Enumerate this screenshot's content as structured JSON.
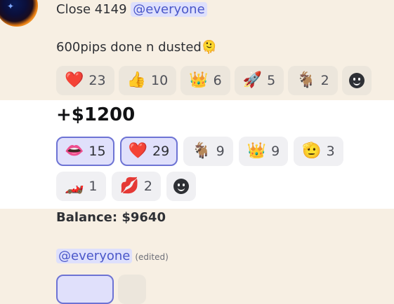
{
  "message1": {
    "prefix": "Close 4149 ",
    "mention": "@everyone",
    "body": "600pips done n dusted",
    "body_emoji": "🫠",
    "reactions": [
      {
        "emoji": "❤️",
        "count": "23"
      },
      {
        "emoji": "👍",
        "count": "10"
      },
      {
        "emoji": "👑",
        "count": "6"
      },
      {
        "emoji": "🚀",
        "count": "5"
      },
      {
        "emoji": "🐐",
        "count": "2"
      }
    ]
  },
  "message2": {
    "amount": "+$1200",
    "reactions": [
      {
        "emoji": "👄",
        "count": "15",
        "me": true
      },
      {
        "emoji": "❤️",
        "count": "29",
        "me": true
      },
      {
        "emoji": "🐐",
        "count": "9"
      },
      {
        "emoji": "👑",
        "count": "9"
      },
      {
        "emoji": "🫡",
        "count": "3"
      },
      {
        "emoji": "🏎️",
        "count": "1"
      },
      {
        "emoji": "💋",
        "count": "2"
      }
    ]
  },
  "message3": {
    "balance": "Balance: $9640"
  },
  "message4": {
    "mention": "@everyone",
    "edited": "(edited)"
  },
  "colors": {
    "background": "#f7efe3",
    "highlight_band": "#ffffff",
    "mention_bg": "#dee0fc",
    "mention_fg": "#4a57c9",
    "selected_border": "#6d73d4"
  },
  "icons": {
    "add_reaction": "smiley-face-icon"
  }
}
